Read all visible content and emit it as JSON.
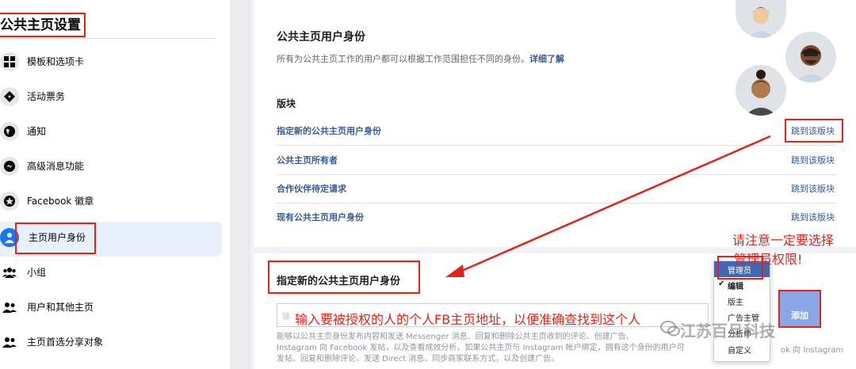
{
  "sidebar": {
    "title": "公共主页设置",
    "items": [
      {
        "label": "模板和选项卡",
        "icon": "grid-icon"
      },
      {
        "label": "活动票务",
        "icon": "ticket-icon"
      },
      {
        "label": "通知",
        "icon": "globe-icon"
      },
      {
        "label": "高级消息功能",
        "icon": "messenger-icon"
      },
      {
        "label": "Facebook 徽章",
        "icon": "star-badge-icon"
      },
      {
        "label": "主页用户身份",
        "icon": "person-icon",
        "active": true
      },
      {
        "label": "小组",
        "icon": "group-icon"
      },
      {
        "label": "用户和其他主页",
        "icon": "people-icon"
      },
      {
        "label": "主页首选分享对象",
        "icon": "people-icon"
      }
    ]
  },
  "main": {
    "title": "公共主页用户身份",
    "description": "所有为公共主页工作的用户都可以根据工作范围担任不同的身份。",
    "learn_more": "详细了解",
    "section_label": "版块",
    "rows": [
      {
        "title": "指定新的公共主页用户身份",
        "link": "跳到该版块"
      },
      {
        "title": "公共主页所有者",
        "link": "跳到该版块"
      },
      {
        "title": "合作伙伴待定请求",
        "link": "跳到该版块"
      },
      {
        "title": "现有公共主页用户身份",
        "link": "跳到该版块"
      }
    ]
  },
  "assign": {
    "title": "指定新的公共主页用户身份",
    "input_placeholder": "输",
    "input_annotation": "输入要被授权的人的个人FB主页地址，以便准确查找到这个人",
    "help_lines": [
      "能够以公共主页身份发布内容和发送 Messenger 消息、回复和删除公共主页收到的评论、创建广告、",
      "Instagram 向 Facebook 发帖，以及查看成效分析。如果公共主页与 Instagram 帐户绑定，拥有这个身份的用户可",
      "发帖、回复和删除评论、发送 Direct 消息、同步商家联系方式，以及创建广告。"
    ],
    "help_right": "ok 向 Instagram",
    "add_button": "添加",
    "role_options": [
      {
        "label": "管理员",
        "highlighted": true
      },
      {
        "label": "编辑",
        "checked": true
      },
      {
        "label": "版主"
      },
      {
        "label": "广告主管"
      },
      {
        "label": "分析师"
      },
      {
        "label": "自定义"
      }
    ]
  },
  "annotation": {
    "note_line1": "请注意一定要选择",
    "note_line2": "管理员权限!",
    "color": "#e0241b"
  },
  "watermark": "江苏百旦科技"
}
